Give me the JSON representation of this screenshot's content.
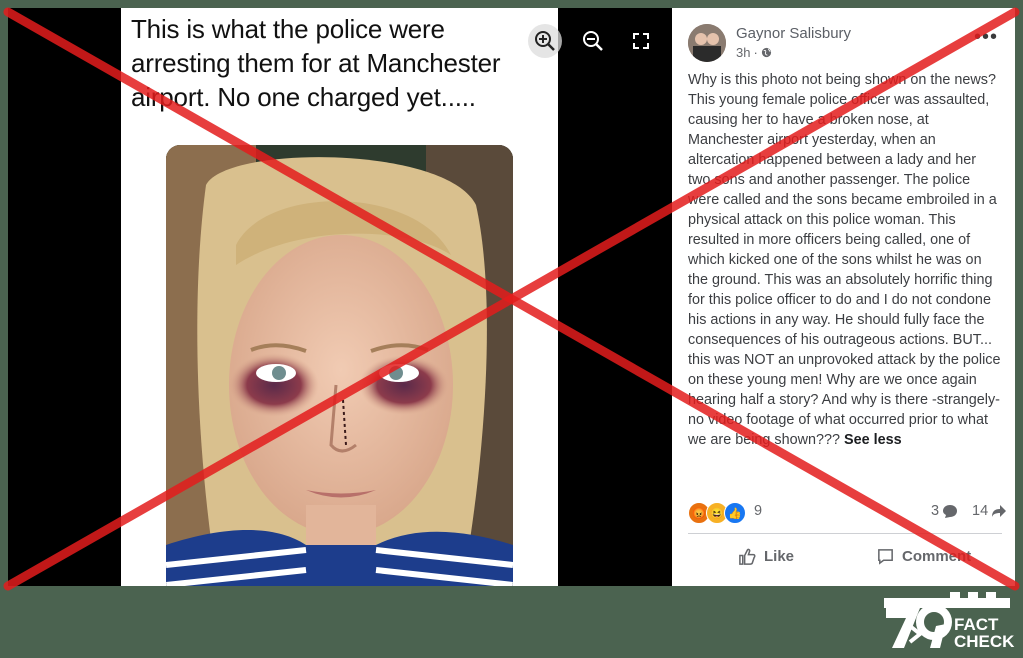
{
  "image_viewer": {
    "tweet_text": "This is what the police were arresting them for at Manchester airport. No one charged yet.....",
    "controls": [
      "zoom-in-icon",
      "zoom-out-icon",
      "fullscreen-icon"
    ]
  },
  "post": {
    "author": "Gaynor Salisbury",
    "time": "3h",
    "privacy_icon": "globe-icon",
    "more_icon": "more-options-icon",
    "body": "Why is this photo not being shown on the news? This young female police officer was assaulted, causing her to have a broken nose, at Manchester airport yesterday, when an altercation happened between a lady and her two sons and another passenger. The police were called and the sons became embroiled in a physical attack on this police woman. This resulted in more officers being called, one of which kicked one of the sons whilst he was on the ground. This was an absolutely horrific thing for this police officer to do and I do not condone his actions in any way. He should fully face the consequences of his outrageous actions. BUT... this was NOT an unprovoked attack by the police on these young men! Why are we once again hearing half a story? And why is there -strangely- no video footage of what occurred prior to what we are being shown???",
    "see_less": "See less",
    "reactions": {
      "icons": [
        "angry-icon",
        "haha-icon",
        "like-icon"
      ],
      "count": "9",
      "comments": "3",
      "shares": "14"
    },
    "actions": {
      "like": "Like",
      "comment": "Comment"
    }
  },
  "overlay": {
    "mark": "red-cross",
    "color": "#e31c1c"
  },
  "logo": {
    "text_top": "FACT",
    "text_bottom": "CHECK",
    "mark": "79"
  },
  "colors": {
    "background": "#4b6350",
    "facebook_text": "#65676b"
  }
}
